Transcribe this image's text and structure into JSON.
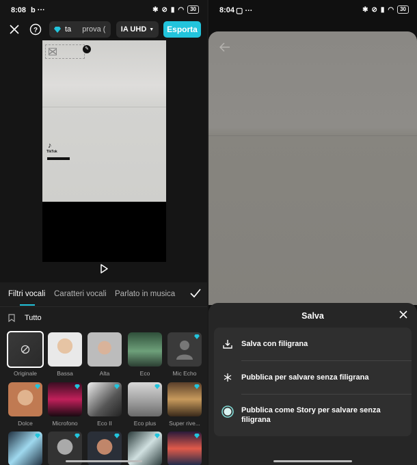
{
  "left": {
    "status": {
      "time": "8:08",
      "extra": "b  ···",
      "battery": "30"
    },
    "topbar": {
      "pill_text_a": "ta",
      "pill_text_b": "prova (",
      "quality": "IA UHD",
      "export": "Esporta"
    },
    "preview": {
      "watermark_text": "TikTok"
    },
    "tabs": [
      "Filtri vocali",
      "Caratteri vocali",
      "Parlato in musica"
    ],
    "category": "Tutto",
    "filters": [
      {
        "label": "Originale",
        "premium": false
      },
      {
        "label": "Bassa",
        "premium": false
      },
      {
        "label": "Alta",
        "premium": false
      },
      {
        "label": "Eco",
        "premium": false
      },
      {
        "label": "Mic Echo",
        "premium": true
      },
      {
        "label": "Dolce",
        "premium": true
      },
      {
        "label": "Microfono",
        "premium": true
      },
      {
        "label": "Eco II",
        "premium": true
      },
      {
        "label": "Eco plus",
        "premium": true
      },
      {
        "label": "Super rive...",
        "premium": true
      },
      {
        "label": "",
        "premium": true
      },
      {
        "label": "",
        "premium": true
      },
      {
        "label": "",
        "premium": true
      },
      {
        "label": "",
        "premium": true
      },
      {
        "label": "",
        "premium": true
      }
    ]
  },
  "right": {
    "status": {
      "time": "8:04",
      "battery": "30"
    },
    "sheet": {
      "title": "Salva",
      "options": [
        "Salva con filigrana",
        "Pubblica per salvare senza filigrana",
        "Pubblica come Story per salvare senza filigrana"
      ]
    }
  },
  "colors": {
    "accent": "#22c4dc",
    "panel": "#1d1d1d",
    "sheet": "#262626"
  }
}
